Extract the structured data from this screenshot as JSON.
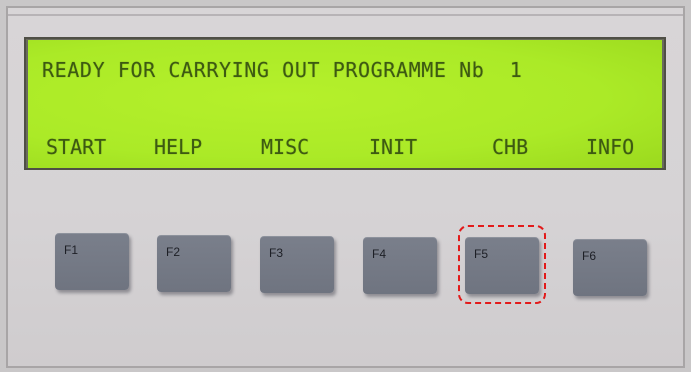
{
  "display": {
    "line1": "READY FOR CARRYING OUT PROGRAMME Nb  1",
    "menu": [
      "START",
      "HELP",
      "MISC",
      "INIT",
      "CHB",
      "INFO"
    ]
  },
  "keys": [
    "F1",
    "F2",
    "F3",
    "F4",
    "F5",
    "F6"
  ],
  "colors": {
    "lcd_background": "#abea27",
    "lcd_text": "#3d5a12",
    "key": "#737884",
    "highlight": "#e21a1a"
  },
  "icons": {
    "highlight": "dashed-red-rounded-rectangle"
  }
}
